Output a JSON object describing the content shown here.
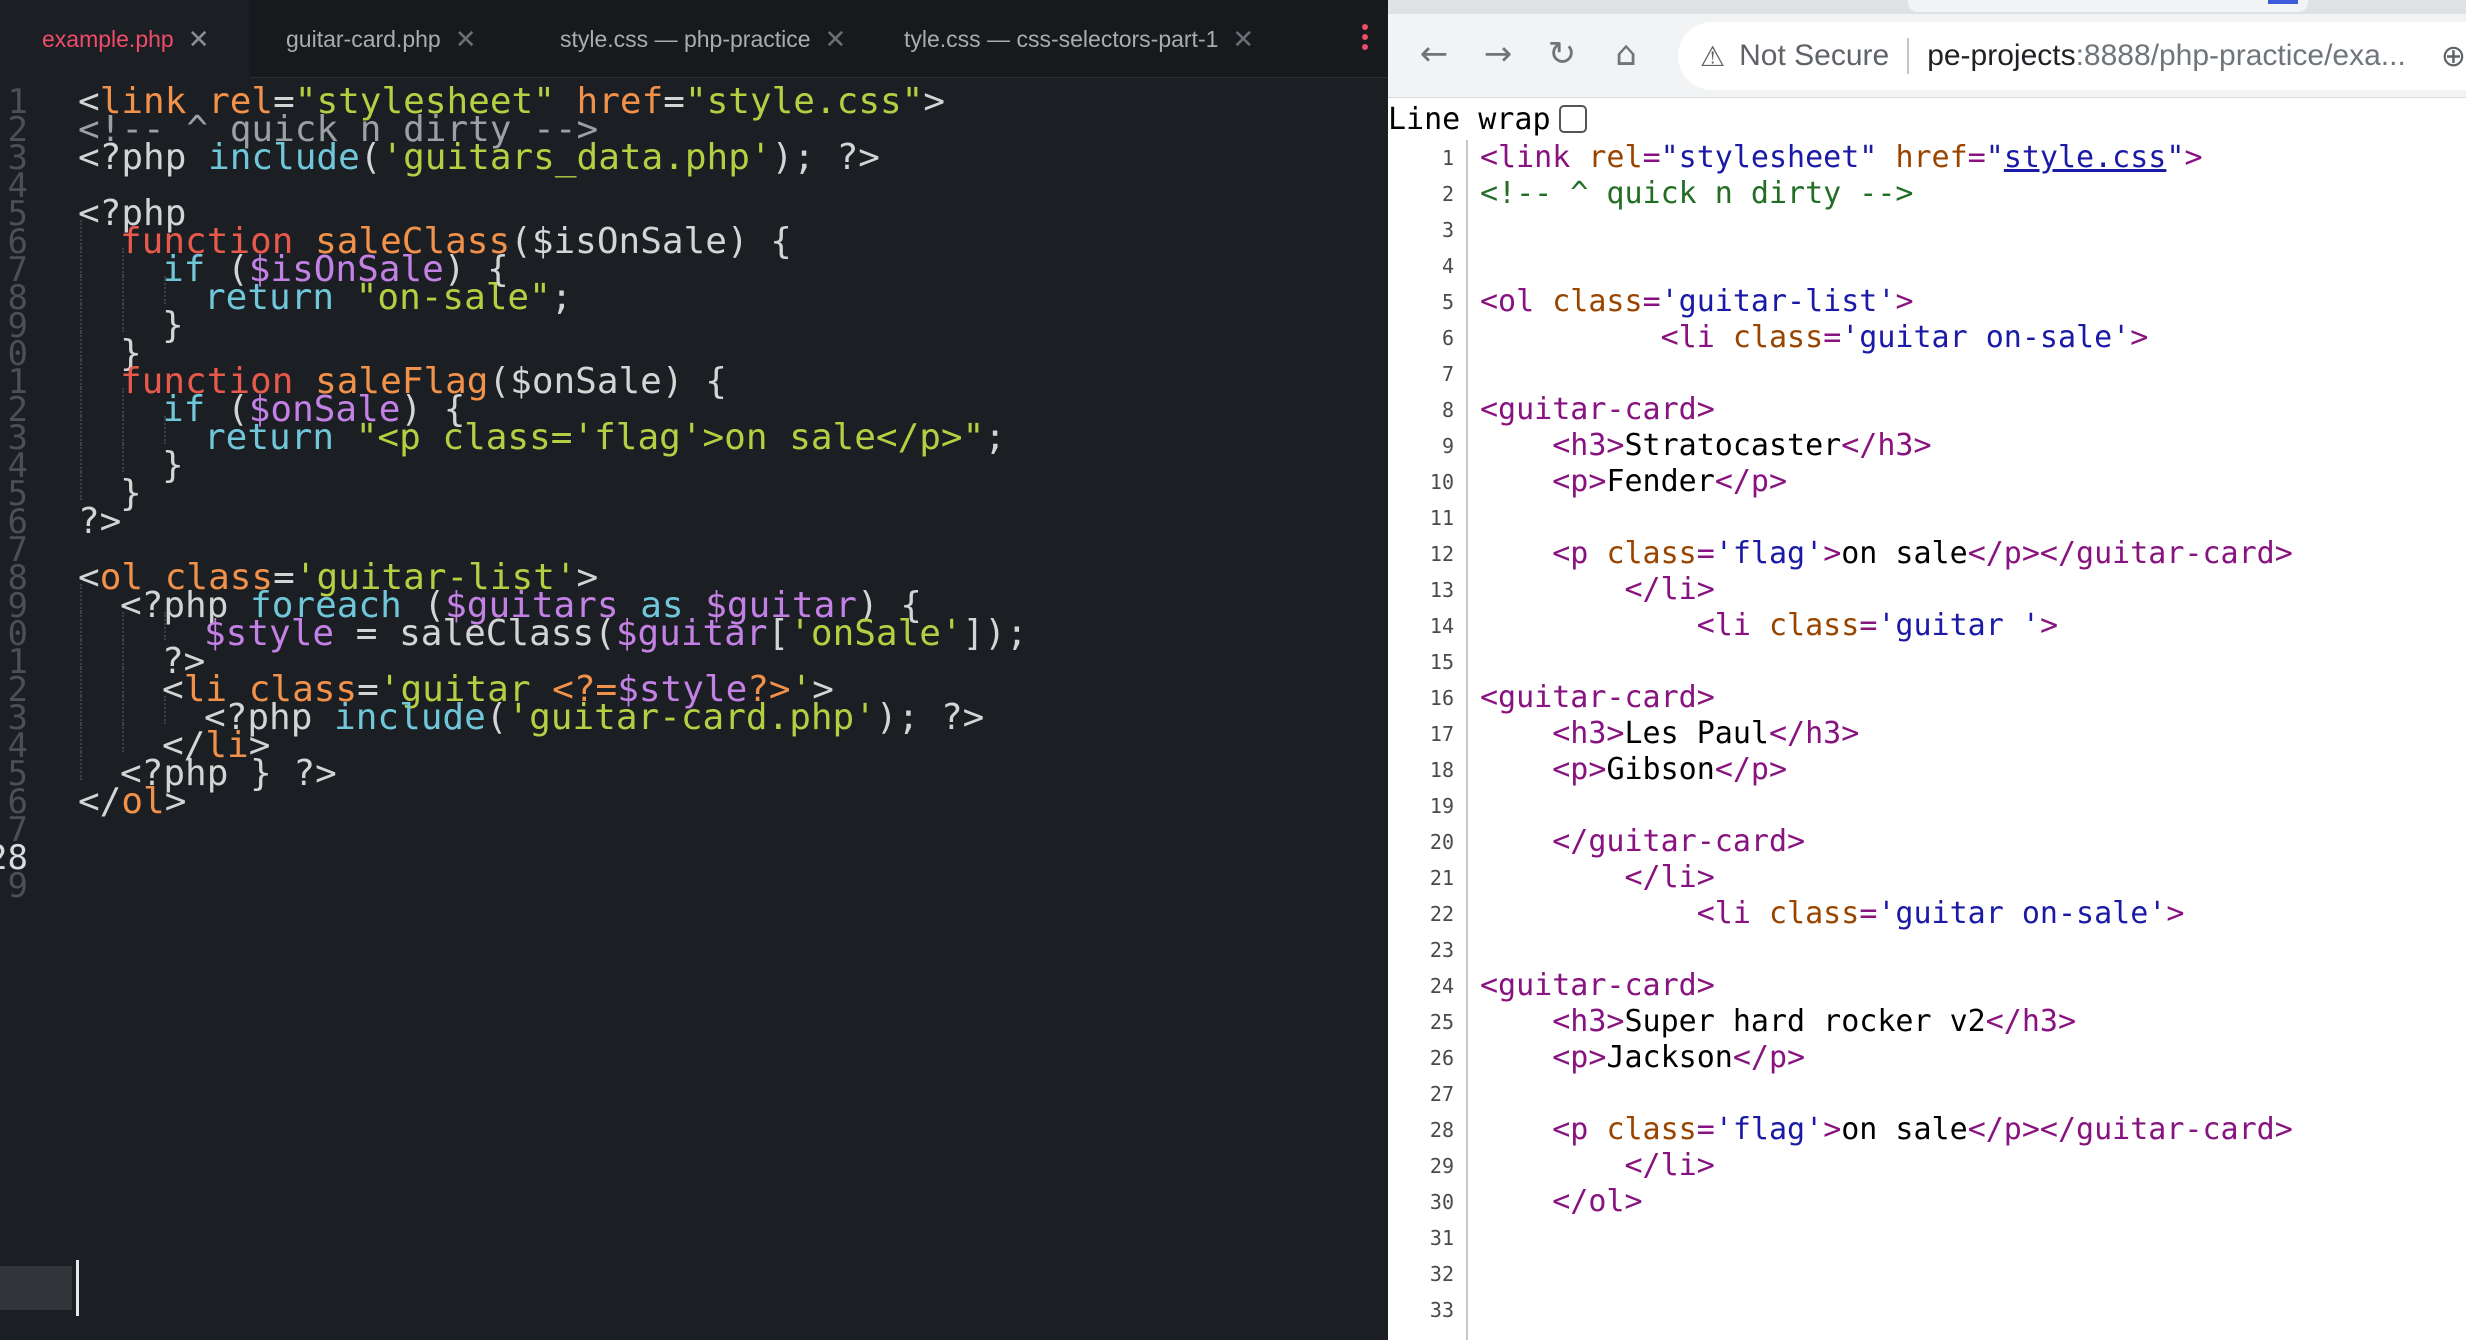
{
  "editor": {
    "tabs": [
      {
        "label": "example.php",
        "active": true
      },
      {
        "label": "guitar-card.php",
        "active": false
      },
      {
        "label": "style.css — php-practice",
        "active": false
      },
      {
        "label": "tyle.css — css-selectors-part-1",
        "active": false
      }
    ],
    "tab_close_icon": "close-icon",
    "line_numbers": [
      "1",
      "2",
      "3",
      "4",
      "5",
      "6",
      "7",
      "8",
      "9",
      "0",
      "1",
      "2",
      "3",
      "4",
      "5",
      "6",
      "7",
      "8",
      "9",
      "0",
      "1",
      "2",
      "3",
      "4",
      "5",
      "6",
      "7",
      "28",
      "9"
    ],
    "current_line": "28",
    "code_lines": [
      {
        "n": 1,
        "indent": 0,
        "parts": [
          [
            "t-php",
            "<"
          ],
          [
            "t-tag",
            "link "
          ],
          [
            "t-attr",
            "rel"
          ],
          [
            "t-plain",
            "="
          ],
          [
            "t-str",
            "\"stylesheet\" "
          ],
          [
            "t-attr",
            "href"
          ],
          [
            "t-plain",
            "="
          ],
          [
            "t-str",
            "\"style.css\""
          ],
          [
            "t-php",
            ">"
          ]
        ]
      },
      {
        "n": 2,
        "indent": 0,
        "parts": [
          [
            "t-com",
            "<!-- ^ quick n dirty -->"
          ]
        ]
      },
      {
        "n": 3,
        "indent": 0,
        "parts": [
          [
            "t-php",
            "<?php "
          ],
          [
            "t-fn",
            "include"
          ],
          [
            "t-plain",
            "("
          ],
          [
            "t-str",
            "'guitars_data.php'"
          ],
          [
            "t-plain",
            "); ?>"
          ]
        ]
      },
      {
        "n": 4,
        "indent": 0,
        "parts": []
      },
      {
        "n": 5,
        "indent": 0,
        "parts": [
          [
            "t-php",
            "<?php"
          ]
        ]
      },
      {
        "n": 6,
        "indent": 1,
        "parts": [
          [
            "t-kw",
            "function "
          ],
          [
            "t-def",
            "saleClass"
          ],
          [
            "t-plain",
            "($isOnSale) {"
          ]
        ]
      },
      {
        "n": 7,
        "indent": 2,
        "parts": [
          [
            "t-fn",
            "if "
          ],
          [
            "t-plain",
            "("
          ],
          [
            "t-var",
            "$isOnSale"
          ],
          [
            "t-plain",
            ") {"
          ]
        ]
      },
      {
        "n": 8,
        "indent": 3,
        "parts": [
          [
            "t-fn",
            "return "
          ],
          [
            "t-str",
            "\"on-sale\""
          ],
          [
            "t-plain",
            ";"
          ]
        ]
      },
      {
        "n": 9,
        "indent": 2,
        "parts": [
          [
            "t-plain",
            "}"
          ]
        ]
      },
      {
        "n": 10,
        "indent": 1,
        "parts": [
          [
            "t-plain",
            "}"
          ]
        ]
      },
      {
        "n": 11,
        "indent": 1,
        "parts": [
          [
            "t-kw",
            "function "
          ],
          [
            "t-def",
            "saleFlag"
          ],
          [
            "t-plain",
            "($onSale) {"
          ]
        ]
      },
      {
        "n": 12,
        "indent": 2,
        "parts": [
          [
            "t-fn",
            "if "
          ],
          [
            "t-plain",
            "("
          ],
          [
            "t-var",
            "$onSale"
          ],
          [
            "t-plain",
            ") {"
          ]
        ]
      },
      {
        "n": 13,
        "indent": 3,
        "parts": [
          [
            "t-fn",
            "return "
          ],
          [
            "t-str",
            "\"<p class='flag'>on sale</p>\""
          ],
          [
            "t-plain",
            ";"
          ]
        ]
      },
      {
        "n": 14,
        "indent": 2,
        "parts": [
          [
            "t-plain",
            "}"
          ]
        ]
      },
      {
        "n": 15,
        "indent": 1,
        "parts": [
          [
            "t-plain",
            "}"
          ]
        ]
      },
      {
        "n": 16,
        "indent": 0,
        "parts": [
          [
            "t-php",
            "?>"
          ]
        ]
      },
      {
        "n": 17,
        "indent": 0,
        "parts": []
      },
      {
        "n": 18,
        "indent": 0,
        "parts": [
          [
            "t-php",
            "<"
          ],
          [
            "t-tag",
            "ol "
          ],
          [
            "t-attr",
            "class"
          ],
          [
            "t-plain",
            "="
          ],
          [
            "t-str",
            "'guitar-list'"
          ],
          [
            "t-php",
            ">"
          ]
        ]
      },
      {
        "n": 19,
        "indent": 1,
        "parts": [
          [
            "t-php",
            "<?php "
          ],
          [
            "t-fn",
            "foreach "
          ],
          [
            "t-plain",
            "("
          ],
          [
            "t-var",
            "$guitars "
          ],
          [
            "t-fn",
            "as "
          ],
          [
            "t-var",
            "$guitar"
          ],
          [
            "t-plain",
            ") {"
          ]
        ]
      },
      {
        "n": 20,
        "indent": 3,
        "parts": [
          [
            "t-var",
            "$style "
          ],
          [
            "t-plain",
            "= saleClass("
          ],
          [
            "t-var",
            "$guitar"
          ],
          [
            "t-plain",
            "["
          ],
          [
            "t-str",
            "'onSale'"
          ],
          [
            "t-plain",
            "]);"
          ]
        ]
      },
      {
        "n": 21,
        "indent": 2,
        "parts": [
          [
            "t-php",
            "?>"
          ]
        ]
      },
      {
        "n": 22,
        "indent": 2,
        "parts": [
          [
            "t-php",
            "<"
          ],
          [
            "t-tag",
            "li "
          ],
          [
            "t-attr",
            "class"
          ],
          [
            "t-plain",
            "="
          ],
          [
            "t-str",
            "'guitar "
          ],
          [
            "t-def",
            "<?="
          ],
          [
            "t-var",
            "$style"
          ],
          [
            "t-def",
            "?>"
          ],
          [
            "t-str",
            "'"
          ],
          [
            "t-php",
            ">"
          ]
        ]
      },
      {
        "n": 23,
        "indent": 3,
        "parts": [
          [
            "t-php",
            "<?php "
          ],
          [
            "t-fn",
            "include"
          ],
          [
            "t-plain",
            "("
          ],
          [
            "t-str",
            "'guitar-card.php'"
          ],
          [
            "t-plain",
            "); ?>"
          ]
        ]
      },
      {
        "n": 24,
        "indent": 2,
        "parts": [
          [
            "t-php",
            "</"
          ],
          [
            "t-tag",
            "li"
          ],
          [
            "t-php",
            ">"
          ]
        ]
      },
      {
        "n": 25,
        "indent": 1,
        "parts": [
          [
            "t-php",
            "<?php } ?>"
          ]
        ]
      },
      {
        "n": 26,
        "indent": 0,
        "parts": [
          [
            "t-php",
            "</"
          ],
          [
            "t-tag",
            "ol"
          ],
          [
            "t-php",
            ">"
          ]
        ]
      },
      {
        "n": 27,
        "indent": 0,
        "parts": []
      },
      {
        "n": 28,
        "indent": 0,
        "parts": []
      }
    ]
  },
  "browser": {
    "nav_icons": [
      "back-icon",
      "forward-icon",
      "reload-icon",
      "home-icon"
    ],
    "security_label": "Not Secure",
    "url_host": "pe-projects",
    "url_rest": ":8888/php-practice/exa...",
    "zoom_icon": "zoom-icon",
    "line_wrap_label": "Line wrap",
    "line_wrap_checked": false,
    "source_lines": [
      {
        "n": "1",
        "parts": [
          [
            "s-tag",
            "<link "
          ],
          [
            "s-an",
            "rel"
          ],
          [
            "s-tag",
            "="
          ],
          [
            "s-av",
            "\"stylesheet\" "
          ],
          [
            "s-an",
            "href"
          ],
          [
            "s-tag",
            "="
          ],
          [
            "s-av",
            "\""
          ],
          [
            "s-link",
            "style.css"
          ],
          [
            "s-av",
            "\""
          ],
          [
            "s-tag",
            ">"
          ]
        ]
      },
      {
        "n": "2",
        "parts": [
          [
            "s-com",
            "<!-- ^ quick n dirty -->"
          ]
        ]
      },
      {
        "n": "3",
        "parts": []
      },
      {
        "n": "4",
        "parts": []
      },
      {
        "n": "5",
        "parts": [
          [
            "s-tag",
            "<ol "
          ],
          [
            "s-an",
            "class"
          ],
          [
            "s-tag",
            "="
          ],
          [
            "s-av",
            "'guitar-list'"
          ],
          [
            "s-tag",
            ">"
          ]
        ]
      },
      {
        "n": "6",
        "parts": [
          [
            "",
            "          "
          ],
          [
            "s-tag",
            "<li "
          ],
          [
            "s-an",
            "class"
          ],
          [
            "s-tag",
            "="
          ],
          [
            "s-av",
            "'guitar on-sale'"
          ],
          [
            "s-tag",
            ">"
          ]
        ]
      },
      {
        "n": "7",
        "parts": []
      },
      {
        "n": "8",
        "parts": [
          [
            "s-tag",
            "<guitar-card>"
          ]
        ]
      },
      {
        "n": "9",
        "parts": [
          [
            "",
            "    "
          ],
          [
            "s-tag",
            "<h3>"
          ],
          [
            "",
            "Stratocaster"
          ],
          [
            "s-tag",
            "</h3>"
          ]
        ]
      },
      {
        "n": "10",
        "parts": [
          [
            "",
            "    "
          ],
          [
            "s-tag",
            "<p>"
          ],
          [
            "",
            "Fender"
          ],
          [
            "s-tag",
            "</p>"
          ]
        ]
      },
      {
        "n": "11",
        "parts": []
      },
      {
        "n": "12",
        "parts": [
          [
            "",
            "    "
          ],
          [
            "s-tag",
            "<p "
          ],
          [
            "s-an",
            "class"
          ],
          [
            "s-tag",
            "="
          ],
          [
            "s-av",
            "'flag'"
          ],
          [
            "s-tag",
            ">"
          ],
          [
            "",
            "on sale"
          ],
          [
            "s-tag",
            "</p></guitar-card>"
          ]
        ]
      },
      {
        "n": "13",
        "parts": [
          [
            "",
            "        "
          ],
          [
            "s-tag",
            "</li>"
          ]
        ]
      },
      {
        "n": "14",
        "parts": [
          [
            "",
            "            "
          ],
          [
            "s-tag",
            "<li "
          ],
          [
            "s-an",
            "class"
          ],
          [
            "s-tag",
            "="
          ],
          [
            "s-av",
            "'guitar '"
          ],
          [
            "s-tag",
            ">"
          ]
        ]
      },
      {
        "n": "15",
        "parts": []
      },
      {
        "n": "16",
        "parts": [
          [
            "s-tag",
            "<guitar-card>"
          ]
        ]
      },
      {
        "n": "17",
        "parts": [
          [
            "",
            "    "
          ],
          [
            "s-tag",
            "<h3>"
          ],
          [
            "",
            "Les Paul"
          ],
          [
            "s-tag",
            "</h3>"
          ]
        ]
      },
      {
        "n": "18",
        "parts": [
          [
            "",
            "    "
          ],
          [
            "s-tag",
            "<p>"
          ],
          [
            "",
            "Gibson"
          ],
          [
            "s-tag",
            "</p>"
          ]
        ]
      },
      {
        "n": "19",
        "parts": []
      },
      {
        "n": "20",
        "parts": [
          [
            "",
            "    "
          ],
          [
            "s-tag",
            "</guitar-card>"
          ]
        ]
      },
      {
        "n": "21",
        "parts": [
          [
            "",
            "        "
          ],
          [
            "s-tag",
            "</li>"
          ]
        ]
      },
      {
        "n": "22",
        "parts": [
          [
            "",
            "            "
          ],
          [
            "s-tag",
            "<li "
          ],
          [
            "s-an",
            "class"
          ],
          [
            "s-tag",
            "="
          ],
          [
            "s-av",
            "'guitar on-sale'"
          ],
          [
            "s-tag",
            ">"
          ]
        ]
      },
      {
        "n": "23",
        "parts": []
      },
      {
        "n": "24",
        "parts": [
          [
            "s-tag",
            "<guitar-card>"
          ]
        ]
      },
      {
        "n": "25",
        "parts": [
          [
            "",
            "    "
          ],
          [
            "s-tag",
            "<h3>"
          ],
          [
            "",
            "Super hard rocker v2"
          ],
          [
            "s-tag",
            "</h3>"
          ]
        ]
      },
      {
        "n": "26",
        "parts": [
          [
            "",
            "    "
          ],
          [
            "s-tag",
            "<p>"
          ],
          [
            "",
            "Jackson"
          ],
          [
            "s-tag",
            "</p>"
          ]
        ]
      },
      {
        "n": "27",
        "parts": []
      },
      {
        "n": "28",
        "parts": [
          [
            "",
            "    "
          ],
          [
            "s-tag",
            "<p "
          ],
          [
            "s-an",
            "class"
          ],
          [
            "s-tag",
            "="
          ],
          [
            "s-av",
            "'flag'"
          ],
          [
            "s-tag",
            ">"
          ],
          [
            "",
            "on sale"
          ],
          [
            "s-tag",
            "</p></guitar-card>"
          ]
        ]
      },
      {
        "n": "29",
        "parts": [
          [
            "",
            "        "
          ],
          [
            "s-tag",
            "</li>"
          ]
        ]
      },
      {
        "n": "30",
        "parts": [
          [
            "",
            "    "
          ],
          [
            "s-tag",
            "</ol>"
          ]
        ]
      },
      {
        "n": "31",
        "parts": []
      },
      {
        "n": "32",
        "parts": []
      },
      {
        "n": "33",
        "parts": []
      }
    ]
  }
}
